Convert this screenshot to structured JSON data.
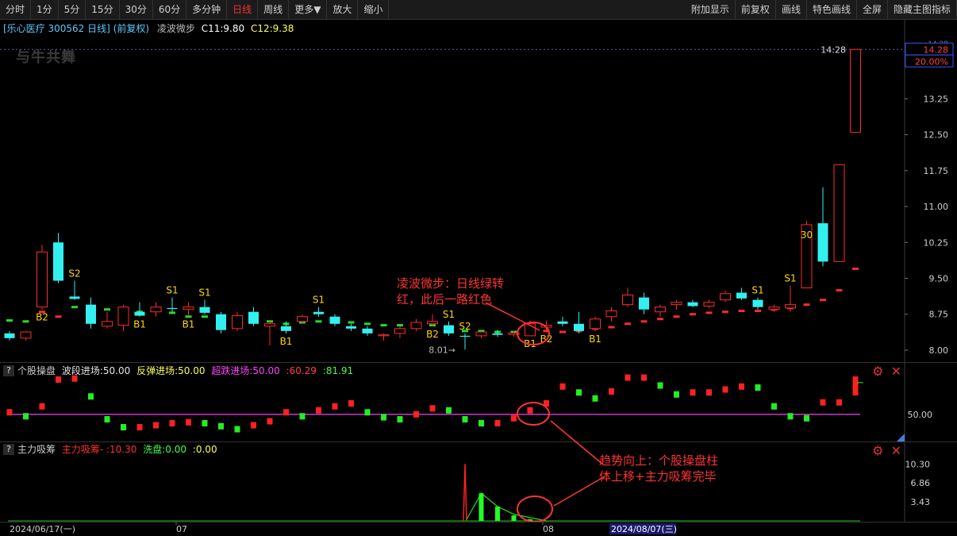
{
  "toolbar": {
    "left": [
      "分时",
      "1分",
      "5分",
      "15分",
      "30分",
      "60分",
      "多分钟",
      "日线",
      "周线",
      "更多▼",
      "放大",
      "缩小"
    ],
    "active": "日线",
    "right": [
      "附加显示",
      "前复权",
      "画线",
      "特色画线",
      "全屏",
      "隐藏主图指标"
    ]
  },
  "header": {
    "stock": "[乐心医疗 300562 日线]",
    "adjust": "(前复权)",
    "indicator": "凌波微步",
    "c11": "C11:9.80",
    "c12": "C12:9.38"
  },
  "watermark": "与牛共舞",
  "colors": {
    "up": "#ff2a2a",
    "down": "#33f0f0",
    "signal": "#ffd700",
    "annotation": "#ff3333"
  },
  "main_panel": {
    "price_ticks": [
      "13.25",
      "12.50",
      "11.75",
      "11.00",
      "10.25",
      "9.50",
      "8.75",
      "8.00"
    ],
    "top_tick_partial": "14.28",
    "last_price": "14.28",
    "last_pct": "20.00%",
    "last_time": "14:28",
    "low_label": "8.01",
    "annotation_1": [
      "凌波微步：日线绿转",
      "红，此后一路红色"
    ]
  },
  "panel2": {
    "title": "个股操盘",
    "v1": "波段进场:50.00",
    "v2": "反弹进场:50.00",
    "v3": "超跌进场:50.00",
    "v4": ":60.29",
    "v5": ":81.91",
    "tick": "50.00"
  },
  "panel3": {
    "title": "主力吸筹",
    "v1": "主力吸筹- :10.30",
    "v2": "洗盘:0.00",
    "v3": ":0.00",
    "ticks": [
      "10.30",
      "6.86",
      "3.43"
    ],
    "annotation_2": [
      "趋势向上：个股操盘柱",
      "体上移+主力吸筹完毕"
    ]
  },
  "x_axis": {
    "labels": [
      "2024/06/17(一)",
      "07",
      "08",
      "2024/08/07(三)"
    ]
  },
  "chart_data": [
    {
      "type": "candlestick",
      "title": "乐心医疗 300562 日线",
      "ylim": [
        7.85,
        14.45
      ],
      "candles": [
        {
          "o": 8.35,
          "h": 8.4,
          "l": 8.2,
          "c": 8.25,
          "sig": ""
        },
        {
          "o": 8.25,
          "h": 8.4,
          "l": 8.2,
          "c": 8.38,
          "sig": ""
        },
        {
          "o": 8.9,
          "h": 10.2,
          "l": 8.85,
          "c": 10.05,
          "sig": "B2"
        },
        {
          "o": 10.25,
          "h": 10.45,
          "l": 9.4,
          "c": 9.45,
          "sig": ""
        },
        {
          "o": 9.12,
          "h": 9.45,
          "l": 9.05,
          "c": 9.07,
          "sig": "S2"
        },
        {
          "o": 8.95,
          "h": 9.1,
          "l": 8.45,
          "c": 8.55,
          "sig": ""
        },
        {
          "o": 8.5,
          "h": 8.8,
          "l": 8.45,
          "c": 8.6,
          "sig": ""
        },
        {
          "o": 8.52,
          "h": 8.95,
          "l": 8.4,
          "c": 8.9,
          "sig": ""
        },
        {
          "o": 8.8,
          "h": 9.0,
          "l": 8.7,
          "c": 8.72,
          "sig": "B1"
        },
        {
          "o": 8.8,
          "h": 9.0,
          "l": 8.7,
          "c": 8.9,
          "sig": ""
        },
        {
          "o": 8.88,
          "h": 9.1,
          "l": 8.8,
          "c": 8.86,
          "sig": "S1"
        },
        {
          "o": 8.85,
          "h": 9.0,
          "l": 8.7,
          "c": 8.9,
          "sig": "B1"
        },
        {
          "o": 8.9,
          "h": 9.05,
          "l": 8.75,
          "c": 8.78,
          "sig": "S1"
        },
        {
          "o": 8.75,
          "h": 8.8,
          "l": 8.35,
          "c": 8.42,
          "sig": ""
        },
        {
          "o": 8.45,
          "h": 8.8,
          "l": 8.4,
          "c": 8.72,
          "sig": ""
        },
        {
          "o": 8.8,
          "h": 8.9,
          "l": 8.5,
          "c": 8.55,
          "sig": ""
        },
        {
          "o": 8.5,
          "h": 8.6,
          "l": 8.1,
          "c": 8.55,
          "sig": ""
        },
        {
          "o": 8.5,
          "h": 8.6,
          "l": 8.35,
          "c": 8.4,
          "sig": "B1"
        },
        {
          "o": 8.6,
          "h": 8.75,
          "l": 8.55,
          "c": 8.7,
          "sig": ""
        },
        {
          "o": 8.8,
          "h": 8.9,
          "l": 8.7,
          "c": 8.75,
          "sig": "S1"
        },
        {
          "o": 8.7,
          "h": 8.75,
          "l": 8.5,
          "c": 8.55,
          "sig": ""
        },
        {
          "o": 8.5,
          "h": 8.55,
          "l": 8.4,
          "c": 8.45,
          "sig": ""
        },
        {
          "o": 8.45,
          "h": 8.5,
          "l": 8.3,
          "c": 8.35,
          "sig": ""
        },
        {
          "o": 8.3,
          "h": 8.35,
          "l": 8.2,
          "c": 8.32,
          "sig": ""
        },
        {
          "o": 8.35,
          "h": 8.5,
          "l": 8.25,
          "c": 8.45,
          "sig": ""
        },
        {
          "o": 8.45,
          "h": 8.65,
          "l": 8.4,
          "c": 8.58,
          "sig": ""
        },
        {
          "o": 8.55,
          "h": 8.75,
          "l": 8.5,
          "c": 8.6,
          "sig": "B2"
        },
        {
          "o": 8.52,
          "h": 8.6,
          "l": 8.3,
          "c": 8.35,
          "sig": "S1"
        },
        {
          "o": 8.3,
          "h": 8.35,
          "l": 8.01,
          "c": 8.28,
          "sig": "S2"
        },
        {
          "o": 8.3,
          "h": 8.4,
          "l": 8.25,
          "c": 8.38,
          "sig": ""
        },
        {
          "o": 8.35,
          "h": 8.42,
          "l": 8.28,
          "c": 8.32,
          "sig": ""
        },
        {
          "o": 8.33,
          "h": 8.4,
          "l": 8.28,
          "c": 8.36,
          "sig": ""
        },
        {
          "o": 8.3,
          "h": 8.62,
          "l": 8.3,
          "c": 8.55,
          "sig": "B1"
        },
        {
          "o": 8.48,
          "h": 8.62,
          "l": 8.4,
          "c": 8.52,
          "sig": "B2"
        },
        {
          "o": 8.6,
          "h": 8.7,
          "l": 8.5,
          "c": 8.55,
          "sig": ""
        },
        {
          "o": 8.55,
          "h": 8.8,
          "l": 8.35,
          "c": 8.4,
          "sig": ""
        },
        {
          "o": 8.45,
          "h": 8.7,
          "l": 8.4,
          "c": 8.65,
          "sig": "B1"
        },
        {
          "o": 8.7,
          "h": 8.9,
          "l": 8.6,
          "c": 8.82,
          "sig": ""
        },
        {
          "o": 8.95,
          "h": 9.3,
          "l": 8.9,
          "c": 9.15,
          "sig": ""
        },
        {
          "o": 9.1,
          "h": 9.2,
          "l": 8.75,
          "c": 8.85,
          "sig": ""
        },
        {
          "o": 8.8,
          "h": 8.95,
          "l": 8.7,
          "c": 8.9,
          "sig": ""
        },
        {
          "o": 8.95,
          "h": 9.05,
          "l": 8.85,
          "c": 9.0,
          "sig": ""
        },
        {
          "o": 9.0,
          "h": 9.05,
          "l": 8.9,
          "c": 8.92,
          "sig": ""
        },
        {
          "o": 8.92,
          "h": 9.05,
          "l": 8.88,
          "c": 9.0,
          "sig": ""
        },
        {
          "o": 9.05,
          "h": 9.25,
          "l": 9.0,
          "c": 9.18,
          "sig": ""
        },
        {
          "o": 9.2,
          "h": 9.3,
          "l": 9.05,
          "c": 9.08,
          "sig": ""
        },
        {
          "o": 9.05,
          "h": 9.1,
          "l": 8.85,
          "c": 8.9,
          "sig": "S1"
        },
        {
          "o": 8.85,
          "h": 8.95,
          "l": 8.8,
          "c": 8.9,
          "sig": ""
        },
        {
          "o": 8.88,
          "h": 9.35,
          "l": 8.8,
          "c": 8.95,
          "sig": "S1"
        },
        {
          "o": 9.3,
          "h": 10.7,
          "l": 9.3,
          "c": 10.62,
          "sig": "30"
        },
        {
          "o": 10.65,
          "h": 11.4,
          "l": 9.75,
          "c": 9.85,
          "sig": ""
        },
        {
          "o": 9.85,
          "h": 11.87,
          "l": 9.85,
          "c": 11.87,
          "sig": ""
        },
        {
          "o": 12.55,
          "h": 14.28,
          "l": 12.55,
          "c": 14.28,
          "sig": ""
        }
      ],
      "signal_line": [
        8.62,
        8.6,
        8.8,
        8.7,
        8.9,
        8.88,
        8.85,
        8.85,
        8.8,
        8.82,
        8.78,
        8.7,
        8.7,
        8.65,
        8.65,
        8.62,
        8.6,
        8.55,
        8.58,
        8.6,
        8.6,
        8.58,
        8.55,
        8.52,
        8.52,
        8.52,
        8.52,
        8.45,
        8.4,
        8.4,
        8.38,
        8.38,
        8.38,
        8.4,
        8.38,
        8.4,
        8.45,
        8.48,
        8.55,
        8.6,
        8.65,
        8.7,
        8.75,
        8.78,
        8.8,
        8.82,
        8.82,
        8.85,
        8.88,
        8.95,
        9.05,
        9.25,
        9.7
      ],
      "signal_color": [
        "d",
        "d",
        "u",
        "u",
        "d",
        "d",
        "d",
        "d",
        "d",
        "d",
        "d",
        "d",
        "d",
        "d",
        "d",
        "d",
        "d",
        "d",
        "d",
        "d",
        "d",
        "d",
        "d",
        "d",
        "d",
        "d",
        "d",
        "d",
        "d",
        "d",
        "d",
        "d",
        "d",
        "u",
        "u",
        "u",
        "u",
        "u",
        "u",
        "u",
        "u",
        "u",
        "u",
        "u",
        "u",
        "u",
        "u",
        "u",
        "u",
        "u",
        "u",
        "u",
        "u"
      ]
    },
    {
      "type": "bar",
      "title": "个股操盘",
      "ylim": [
        25,
        85
      ],
      "baseline": 50,
      "values": [
        52,
        48,
        58,
        85,
        86,
        68,
        45,
        37,
        37,
        39,
        41,
        42,
        41,
        38,
        35,
        39,
        43,
        52,
        48,
        54,
        58,
        61,
        52,
        47,
        45,
        50,
        56,
        54,
        45,
        41,
        41,
        46,
        54,
        61,
        78,
        72,
        66,
        73,
        87,
        87,
        79,
        70,
        72,
        72,
        75,
        78,
        77,
        58,
        48,
        46,
        62,
        62,
        85
      ]
    },
    {
      "type": "bar",
      "title": "主力吸筹",
      "ylim": [
        0,
        11.2
      ],
      "values": [
        0,
        0,
        0,
        0,
        0,
        0,
        0,
        0,
        0,
        0,
        0,
        0,
        0,
        0,
        0,
        0,
        0,
        0,
        0,
        0,
        0,
        0,
        0,
        0,
        0,
        0,
        0,
        0,
        10.3,
        5.0,
        2.6,
        1.0,
        0.3,
        0,
        0,
        0,
        0,
        0,
        0,
        0,
        0,
        0,
        0,
        0,
        0,
        0,
        0,
        0,
        0,
        0,
        0,
        0,
        0
      ],
      "wash_line_index": 28,
      "wash_line_peak": 10.3
    }
  ]
}
